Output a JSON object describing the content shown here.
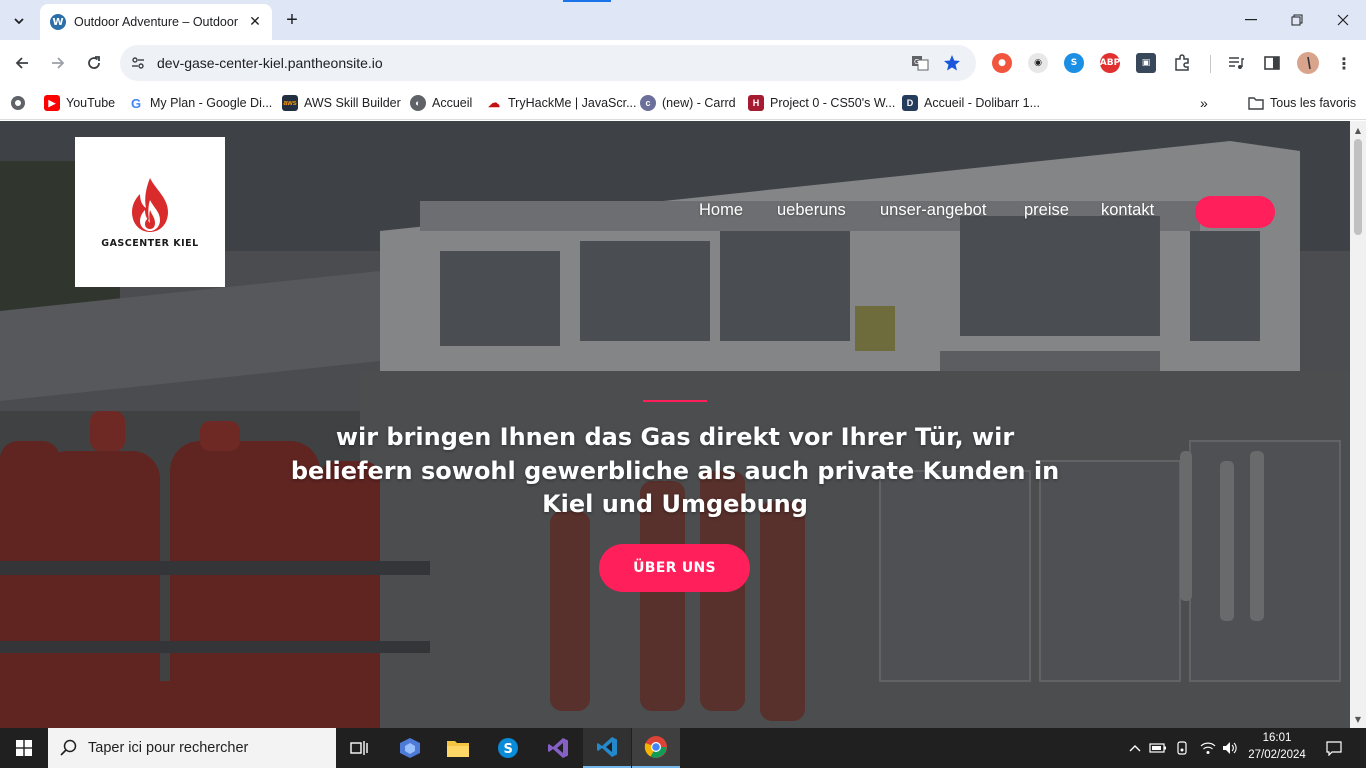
{
  "browser": {
    "tab_title": "Outdoor Adventure – Outdoor",
    "url": "dev-gase-center-kiel.pantheonsite.io",
    "bookmarks": [
      {
        "label": "YouTube",
        "icon": "youtube-icon"
      },
      {
        "label": "My Plan - Google Di...",
        "icon": "google-icon"
      },
      {
        "label": "AWS Skill Builder",
        "icon": "aws-icon"
      },
      {
        "label": "Accueil",
        "icon": "globe-icon"
      },
      {
        "label": "TryHackMe | JavaScr...",
        "icon": "tryhackme-icon"
      },
      {
        "label": "(new) - Carrd",
        "icon": "carrd-icon"
      },
      {
        "label": "Project 0 - CS50's W...",
        "icon": "harvard-icon"
      },
      {
        "label": "Accueil - Dolibarr 1...",
        "icon": "dolibarr-icon"
      }
    ],
    "all_bookmarks_label": "Tous les favoris"
  },
  "site": {
    "logo_text": "GASCENTER KIEL",
    "nav": [
      "Home",
      "ueberuns",
      "unser-angebot",
      "preise",
      "kontakt"
    ],
    "headline": "wir bringen Ihnen das Gas direkt vor Ihrer Tür, wir beliefern sowohl gewerbliche als auch private Kunden in Kiel und Umgebung",
    "cta_label": "ÜBER UNS",
    "accent_color": "#ff1f5a"
  },
  "taskbar": {
    "search_placeholder": "Taper ici pour rechercher",
    "time": "16:01",
    "date": "27/02/2024"
  }
}
